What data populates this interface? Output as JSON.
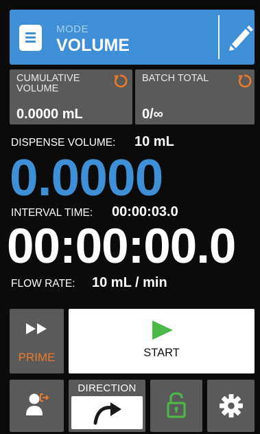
{
  "mode": {
    "label": "MODE",
    "value": "VOLUME",
    "colors": {
      "accent": "#3e8fd6"
    },
    "icons": {
      "mode": "document-icon",
      "edit": "pencil-icon"
    }
  },
  "counters": {
    "cumulative": {
      "label": "CUMULATIVE VOLUME",
      "value": "0.0000 mL",
      "icon": "reset-icon"
    },
    "batch": {
      "label": "BATCH TOTAL",
      "value": "0/∞",
      "icon": "reset-icon"
    },
    "colors": {
      "reset_icon": "#ec7a28"
    }
  },
  "readouts": {
    "dispense_label": "DISPENSE VOLUME:",
    "dispense_value": "10 mL",
    "volume": "0.0000",
    "interval_label": "INTERVAL TIME:",
    "interval_value": "00:00:03.0",
    "time": "00:00:00.0",
    "flow_label": "FLOW RATE:",
    "flow_value": "10 mL / min"
  },
  "controls": {
    "prime_label": "PRIME",
    "start_label": "START",
    "direction_label": "DIRECTION",
    "icons": {
      "prime": "fast-forward-icon",
      "start": "play-icon",
      "user": "user-logout-icon",
      "direction": "curved-arrow-icon",
      "lock": "unlock-icon",
      "settings": "gear-icon"
    },
    "colors": {
      "prime_label": "#ec7a28",
      "play": "#4cb848",
      "lock": "#4cb848"
    }
  }
}
